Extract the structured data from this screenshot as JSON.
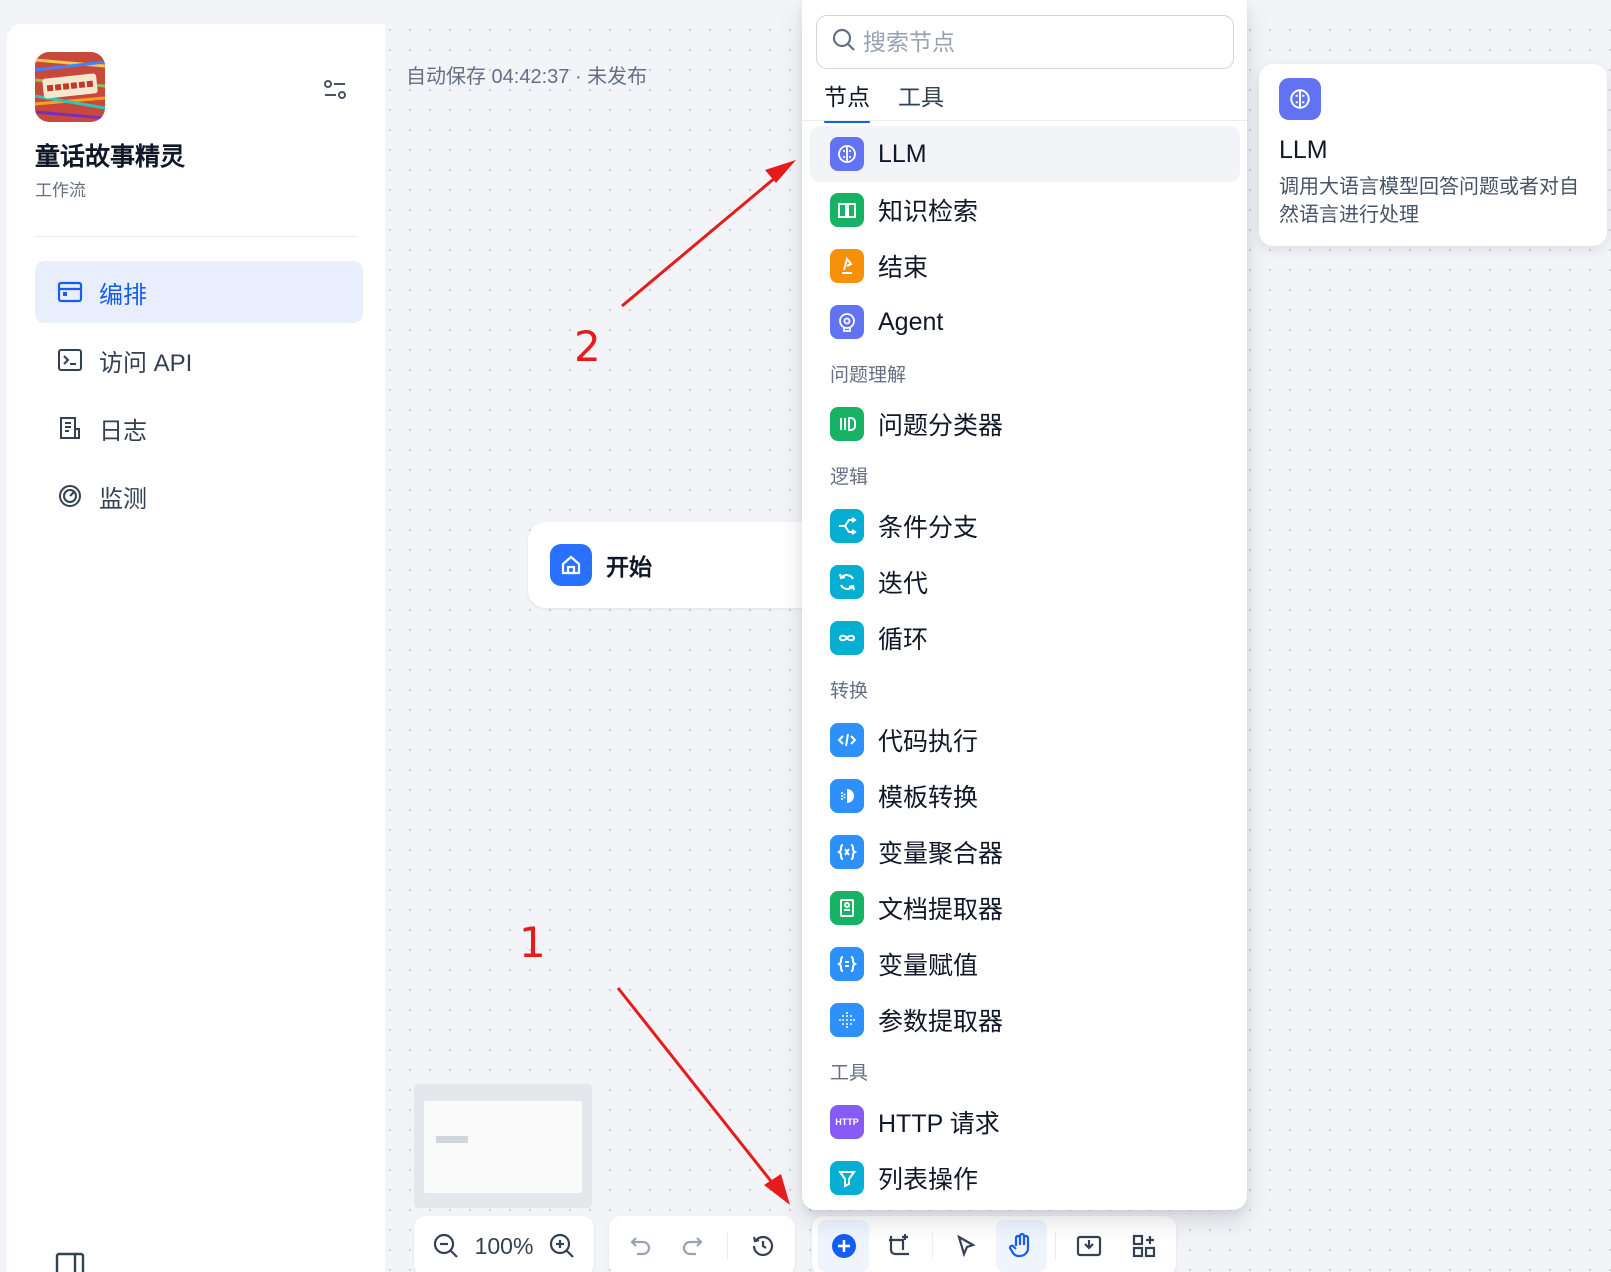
{
  "app": {
    "name": "童话故事精灵",
    "type": "工作流"
  },
  "nav": [
    {
      "label": "编排",
      "icon": "layout-icon",
      "active": true
    },
    {
      "label": "访问 API",
      "icon": "terminal-icon",
      "active": false
    },
    {
      "label": "日志",
      "icon": "log-icon",
      "active": false
    },
    {
      "label": "监测",
      "icon": "gauge-icon",
      "active": false
    }
  ],
  "status": {
    "autosave": "自动保存 04:42:37 · 未发布"
  },
  "canvas": {
    "start_node_label": "开始"
  },
  "zoom": {
    "level": "100%"
  },
  "block_selector": {
    "search_placeholder": "搜索节点",
    "tabs": [
      "节点",
      "工具"
    ],
    "items": {
      "llm": "LLM",
      "knowledge": "知识检索",
      "end": "结束",
      "agent": "Agent",
      "group_understanding": "问题理解",
      "classifier": "问题分类器",
      "group_logic": "逻辑",
      "if_else": "条件分支",
      "iteration": "迭代",
      "loop": "循环",
      "group_transform": "转换",
      "code": "代码执行",
      "template": "模板转换",
      "var_aggregator": "变量聚合器",
      "doc_extractor": "文档提取器",
      "var_assign": "变量赋值",
      "param_extractor": "参数提取器",
      "group_tools": "工具",
      "http_badge": "HTTP",
      "http": "HTTP 请求",
      "list_op": "列表操作"
    }
  },
  "tooltip": {
    "title": "LLM",
    "description": "调用大语言模型回答问题或者对自然语言进行处理"
  },
  "annotations": {
    "one": "1",
    "two": "2"
  },
  "colors": {
    "primary": "#155eef",
    "llm": "#6172f3",
    "green": "#16b364",
    "orange": "#f79009",
    "cyan": "#06aed4",
    "blue": "#2e90fa",
    "violet": "#875bf7",
    "annotation_red": "#e51c1c"
  }
}
